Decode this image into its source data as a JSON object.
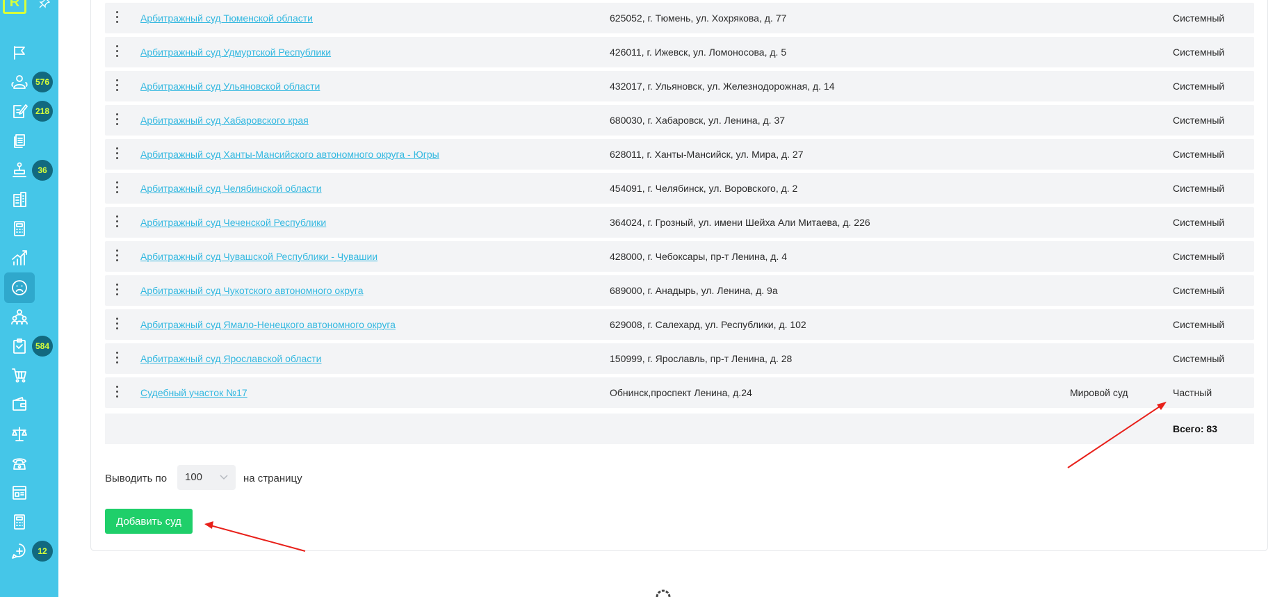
{
  "sidebar": {
    "logo_letter": "R",
    "items": [
      {
        "icon": "flag-icon"
      },
      {
        "icon": "people-icon",
        "badge": "576"
      },
      {
        "icon": "edit-doc-icon",
        "badge": "218"
      },
      {
        "icon": "documents-icon"
      },
      {
        "icon": "stamp-icon",
        "badge": "36"
      },
      {
        "icon": "building-icon"
      },
      {
        "icon": "calculator-icon"
      },
      {
        "icon": "chart-icon"
      },
      {
        "icon": "sad-face-icon",
        "active": true
      },
      {
        "icon": "team-icon"
      },
      {
        "icon": "clipboard-icon",
        "badge": "584"
      },
      {
        "icon": "cart-icon"
      },
      {
        "icon": "wallet-icon"
      },
      {
        "icon": "scales-icon"
      },
      {
        "icon": "phone-icon"
      },
      {
        "icon": "browser-icon"
      },
      {
        "icon": "calculator-icon"
      },
      {
        "icon": "chat-add-icon",
        "badge": "12"
      }
    ]
  },
  "courts": [
    {
      "name": "Арбитражный суд Тюменской области",
      "address": "625052, г. Тюмень, ул. Хохрякова, д. 77",
      "kind": "",
      "source": "Системный"
    },
    {
      "name": "Арбитражный суд Удмуртской Республики",
      "address": "426011, г. Ижевск, ул. Ломоносова, д. 5",
      "kind": "",
      "source": "Системный"
    },
    {
      "name": "Арбитражный суд Ульяновской области",
      "address": "432017, г. Ульяновск, ул. Железнодорожная, д. 14",
      "kind": "",
      "source": "Системный"
    },
    {
      "name": "Арбитражный суд Хабаровского края",
      "address": "680030, г. Хабаровск, ул. Ленина, д. 37",
      "kind": "",
      "source": "Системный"
    },
    {
      "name": "Арбитражный суд Ханты-Мансийского автономного округа - Югры",
      "address": "628011, г. Ханты-Мансийск, ул. Мира, д. 27",
      "kind": "",
      "source": "Системный"
    },
    {
      "name": "Арбитражный суд Челябинской области",
      "address": "454091, г. Челябинск, ул. Воровского, д. 2",
      "kind": "",
      "source": "Системный"
    },
    {
      "name": "Арбитражный суд Чеченской Республики",
      "address": "364024, г. Грозный, ул. имени Шейха Али Митаева, д. 226",
      "kind": "",
      "source": "Системный"
    },
    {
      "name": "Арбитражный суд Чувашской Республики - Чувашии",
      "address": "428000, г. Чебоксары, пр-т Ленина, д. 4",
      "kind": "",
      "source": "Системный"
    },
    {
      "name": "Арбитражный суд Чукотского автономного округа",
      "address": "689000, г. Анадырь, ул. Ленина, д. 9а",
      "kind": "",
      "source": "Системный"
    },
    {
      "name": "Арбитражный суд Ямало-Ненецкого автономного округа",
      "address": "629008, г. Салехард, ул. Республики, д. 102",
      "kind": "",
      "source": "Системный"
    },
    {
      "name": "Арбитражный суд Ярославской области",
      "address": "150999, г. Ярославль, пр-т Ленина, д. 28",
      "kind": "",
      "source": "Системный"
    },
    {
      "name": "Судебный участок №17",
      "address": "Обнинск,проспект Ленина, д.24",
      "kind": "Мировой суд",
      "source": "Частный"
    }
  ],
  "total_label": "Всего: 83",
  "pager": {
    "prefix": "Выводить по",
    "value": "100",
    "suffix": "на страницу"
  },
  "add_button_label": "Добавить суд",
  "colors": {
    "sidebar": "#45c6e8",
    "badge": "#12697f",
    "badge_text": "#d7ff3a",
    "link": "#33b8e0",
    "button": "#1fcf6a",
    "annotation_arrow": "#e8201a"
  }
}
